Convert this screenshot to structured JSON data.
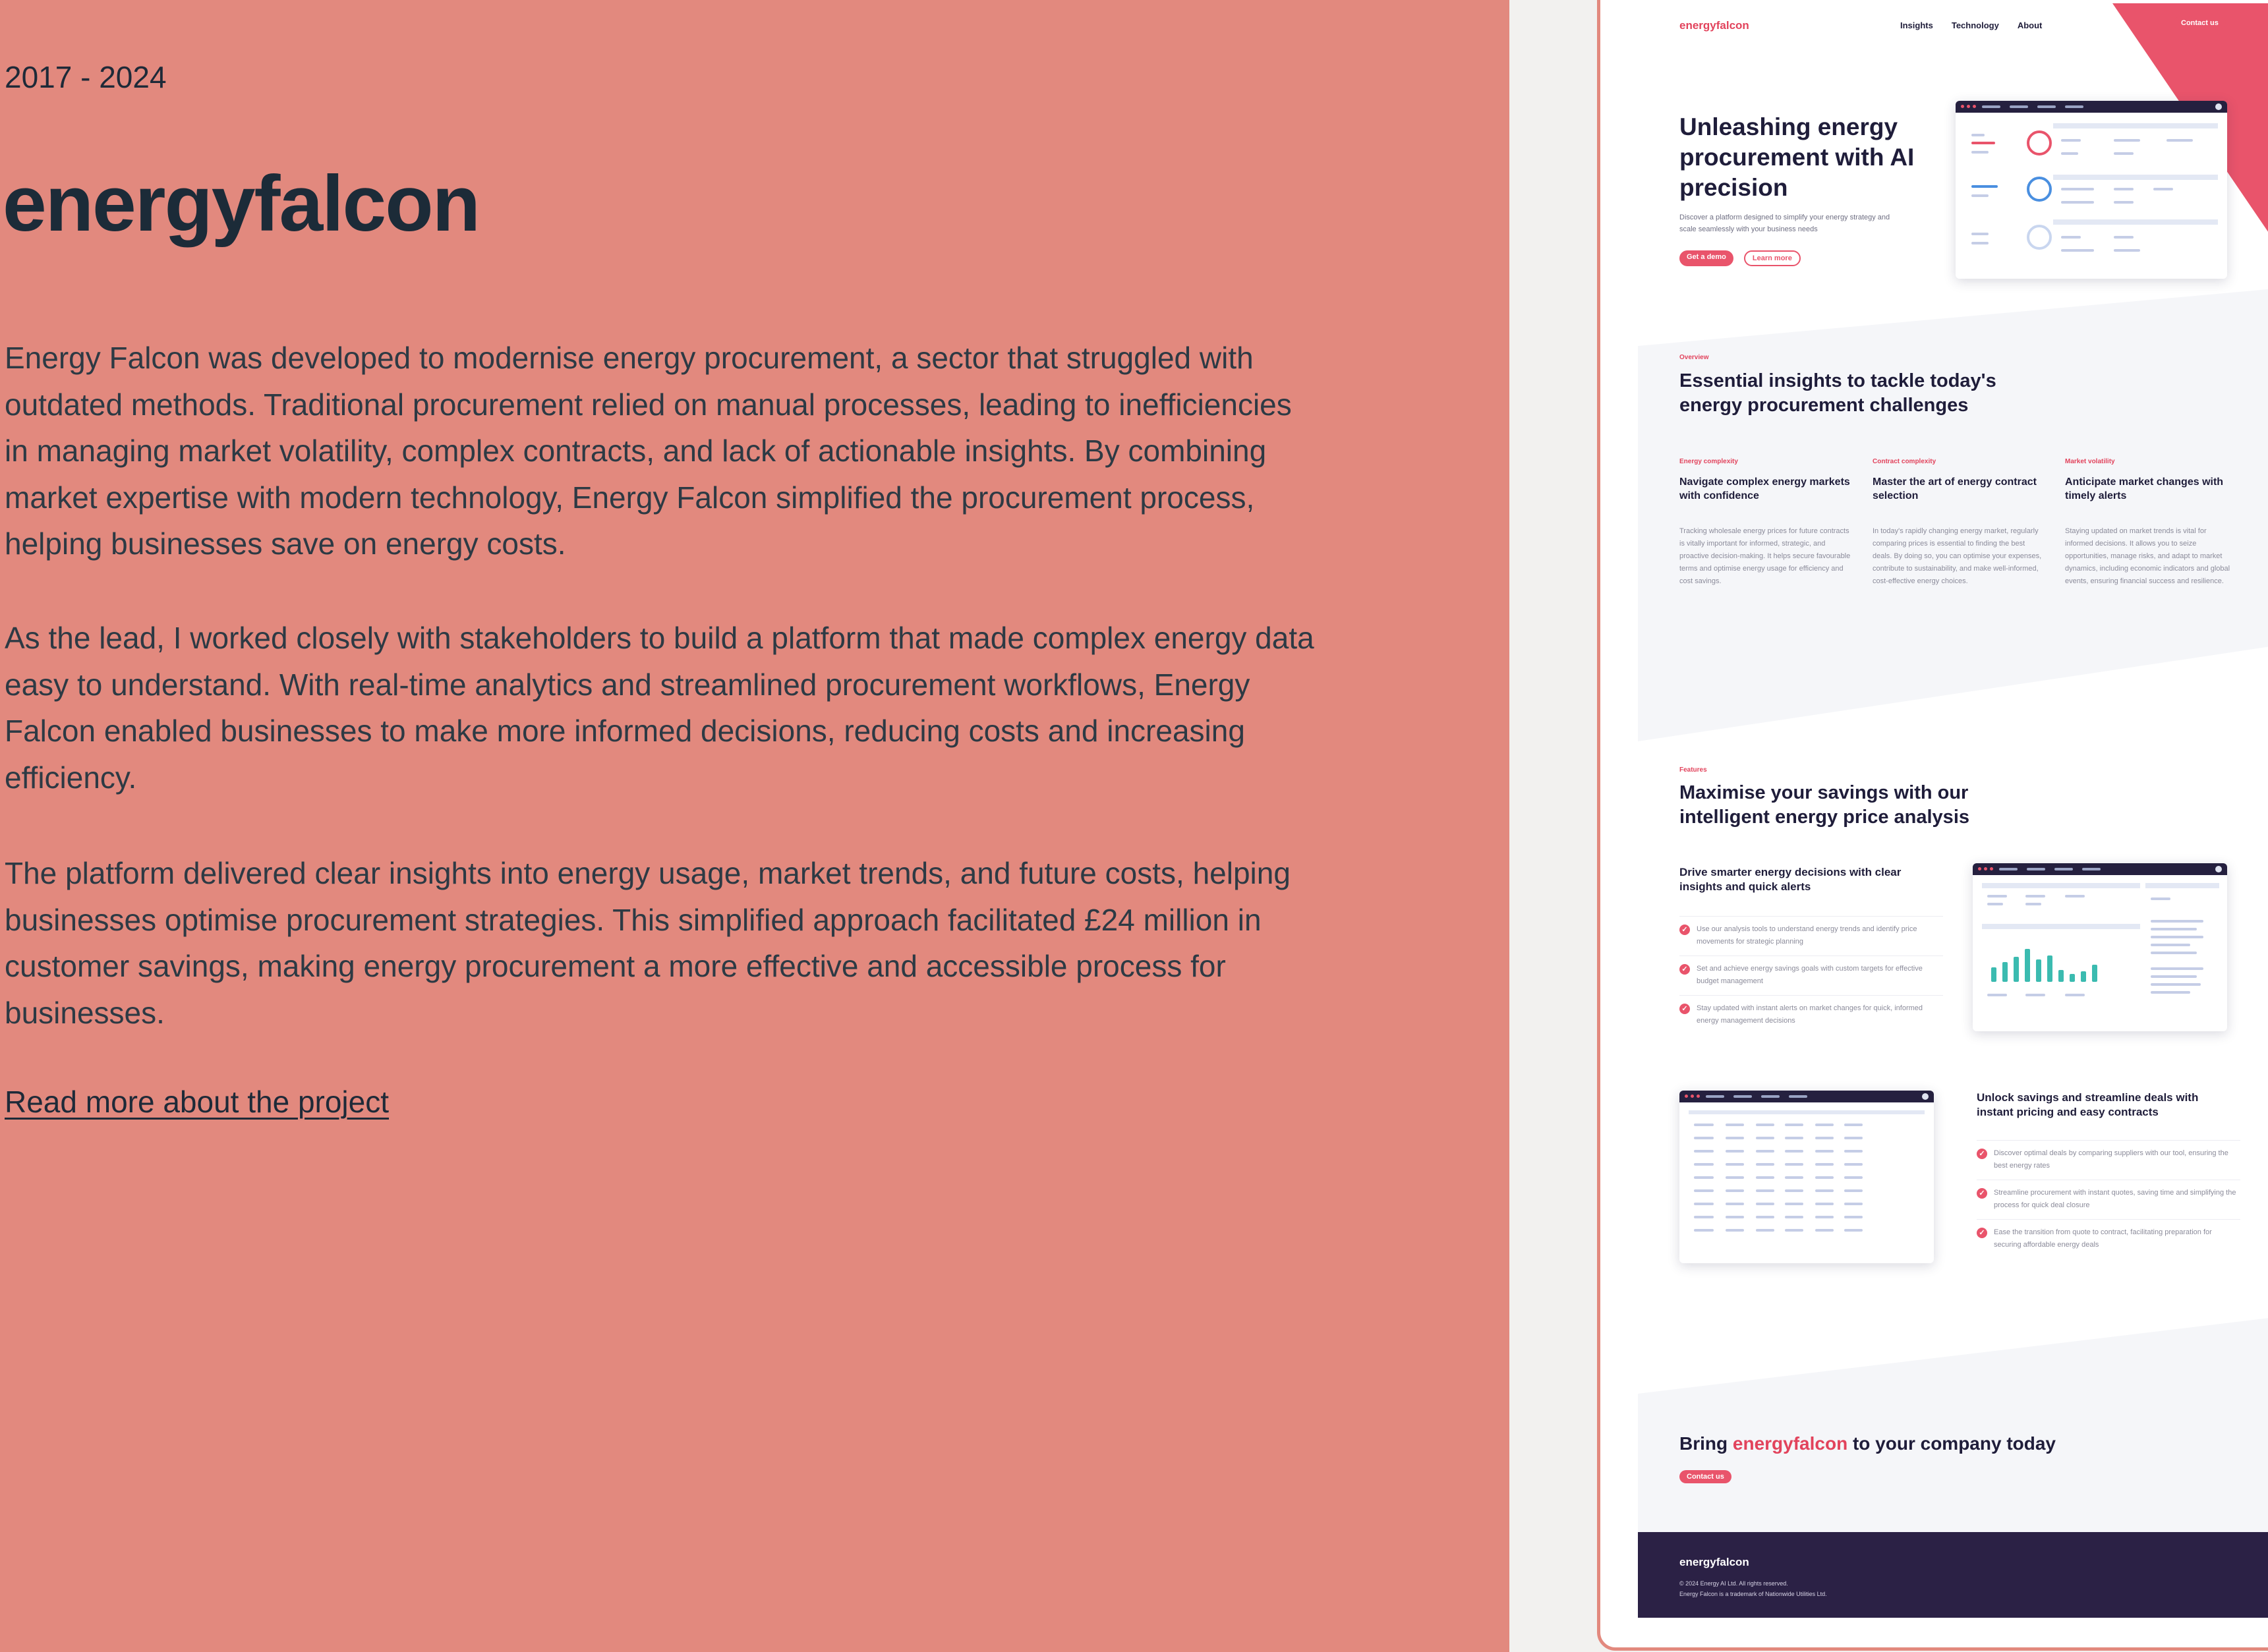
{
  "case_study": {
    "years": "2017 - 2024",
    "title": "energyfalcon",
    "paragraphs": [
      "Energy Falcon was developed to modernise energy procurement, a sector that struggled with outdated methods. Traditional procurement relied on manual processes, leading to inefficiencies in managing market volatility, complex contracts, and lack of actionable insights. By combining market expertise with modern technology, Energy Falcon simplified the procurement process, helping businesses save on energy costs.",
      "As the lead, I worked closely with stakeholders to build a platform that made complex energy data easy to understand. With real-time analytics and streamlined procurement workflows, Energy Falcon enabled businesses to make more informed decisions, reducing costs and increasing efficiency.",
      "The platform delivered clear insights into energy usage, market trends, and future costs, helping businesses optimise procurement strategies. This simplified approach facilitated £24 million in customer savings, making energy procurement a more effective and accessible process for businesses."
    ],
    "read_more": "Read more about the project"
  },
  "site": {
    "logo": "energyfalcon",
    "nav": [
      "Insights",
      "Technology",
      "About"
    ],
    "contact_label": "Contact us",
    "hero": {
      "heading": "Unleashing energy procurement with AI precision",
      "subtext": "Discover a platform designed to simplify your energy strategy and scale seamlessly with your business needs",
      "primary_cta": "Get a demo",
      "secondary_cta": "Learn more"
    },
    "overview": {
      "eyebrow": "Overview",
      "heading": "Essential insights to tackle today's energy procurement challenges",
      "columns": [
        {
          "eyebrow": "Energy complexity",
          "heading": "Navigate complex energy markets with confidence",
          "body": "Tracking wholesale energy prices for future contracts is vitally important for informed, strategic, and proactive decision-making. It helps secure favourable terms and optimise energy usage for efficiency and cost savings."
        },
        {
          "eyebrow": "Contract complexity",
          "heading": "Master the art of energy contract selection",
          "body": "In today's rapidly changing energy market, regularly comparing prices is essential to finding the best deals. By doing so, you can optimise your expenses, contribute to sustainability, and make well-informed, cost-effective energy choices."
        },
        {
          "eyebrow": "Market volatility",
          "heading": "Anticipate market changes with timely alerts",
          "body": "Staying updated on market trends is vital for informed decisions. It allows you to seize opportunities, manage risks, and adapt to market dynamics, including economic indicators and global events, ensuring financial success and resilience."
        }
      ]
    },
    "features": {
      "eyebrow": "Features",
      "heading": "Maximise your savings with our intelligent energy price analysis",
      "block1": {
        "heading": "Drive smarter energy decisions with clear insights and quick alerts",
        "items": [
          "Use our analysis tools to understand energy trends and identify price movements for strategic planning",
          "Set and achieve energy savings goals with custom targets for effective budget management",
          "Stay updated with instant alerts on market changes for quick, informed energy management decisions"
        ]
      },
      "block2": {
        "heading": "Unlock savings and streamline deals with instant pricing and easy contracts",
        "items": [
          "Discover optimal deals by comparing suppliers with our tool, ensuring the best energy rates",
          "Streamline procurement with instant quotes, saving time and simplifying the process for quick deal closure",
          "Ease the transition from quote to contract, facilitating preparation for securing affordable energy deals"
        ]
      }
    },
    "cta": {
      "prefix": "Bring",
      "accent": "energyfalcon",
      "suffix": "to your company today",
      "button": "Contact us"
    },
    "footer": {
      "logo": "energyfalcon",
      "copyright": "© 2024 Energy AI Ltd. All rights reserved.",
      "trademark": "Energy Falcon is a trademark of Nationwide Utilities Ltd."
    }
  },
  "colors": {
    "panel_bg": "#e2897e",
    "brand_red": "#e9546b",
    "navy": "#1f1d3a",
    "footer_bg": "#2b2145",
    "chart_teal": "#3bbbb0"
  },
  "icons": [
    "check-circle-icon",
    "window-dots-icon",
    "avatar-icon"
  ]
}
